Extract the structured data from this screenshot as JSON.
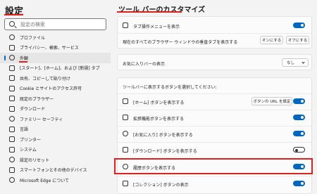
{
  "sidebar": {
    "title": "設定",
    "search_placeholder": "設定の検索",
    "items": [
      {
        "label": "プロファイル",
        "icon": "profile-icon"
      },
      {
        "label": "プライバシー、検索、サービス",
        "icon": "lock-icon"
      },
      {
        "label": "外観",
        "icon": "appearance-icon",
        "active": true
      },
      {
        "label": "[スタート]、[ホーム]、および [新規] タブ",
        "icon": "home-icon"
      },
      {
        "label": "共有、コピーして貼り付け",
        "icon": "share-icon"
      },
      {
        "label": "Cookie とサイトのアクセス許可",
        "icon": "cookie-icon"
      },
      {
        "label": "既定のブラウザー",
        "icon": "browser-icon"
      },
      {
        "label": "ダウンロード",
        "icon": "download-icon"
      },
      {
        "label": "ファミリー セーフティ",
        "icon": "family-icon"
      },
      {
        "label": "言語",
        "icon": "language-icon"
      },
      {
        "label": "プリンター",
        "icon": "printer-icon"
      },
      {
        "label": "システム",
        "icon": "system-icon"
      },
      {
        "label": "設定のリセット",
        "icon": "reset-icon"
      },
      {
        "label": "スマートフォンとその他のデバイス",
        "icon": "phone-icon"
      },
      {
        "label": "Microsoft Edge について",
        "icon": "edge-icon"
      }
    ]
  },
  "main": {
    "title": "ツール バーのカスタマイズ",
    "tab_actions_label": "タブ操作メニューを表示",
    "vertical_tabs_label": "現在のすべてのブラウザー ウィンドウの垂直タブを表示する",
    "vertical_on": "オンにする",
    "vertical_off": "オフにする",
    "favorites_bar_label": "お気に入りバーの表示",
    "favorites_bar_value": "なし",
    "select_buttons_label": "ツールバーに表示するボタンを選択してください:",
    "home_button_label": "[ホーム] ボタンを表示する",
    "home_url_button": "ボタンの URL を設定",
    "extensions_label": "拡張機能ボタンを表示する",
    "favorites_button_label": "[お気に入り] ボタンを表示する",
    "downloads_button_label": "[ダウンロード] ボタンを表示する",
    "history_button_label": "履歴ボタンを表示する",
    "collections_button_label": "[コレクション] ボタンの表示"
  },
  "colors": {
    "accent": "#0067c0",
    "highlight": "#e0201b"
  }
}
